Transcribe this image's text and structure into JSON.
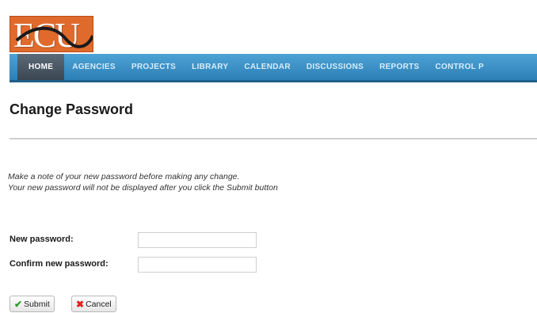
{
  "header": {
    "logo_text": "ECU",
    "nav_items": [
      {
        "label": "HOME",
        "active": true
      },
      {
        "label": "AGENCIES",
        "active": false
      },
      {
        "label": "PROJECTS",
        "active": false
      },
      {
        "label": "LIBRARY",
        "active": false
      },
      {
        "label": "CALENDAR",
        "active": false
      },
      {
        "label": "DISCUSSIONS",
        "active": false
      },
      {
        "label": "REPORTS",
        "active": false
      },
      {
        "label": "CONTROL P",
        "active": false
      }
    ]
  },
  "page": {
    "title": "Change Password",
    "notice_line1": "Make a note of your new password before making any change.",
    "notice_line2": "Your new password will not be displayed after you click the Submit button"
  },
  "form": {
    "new_password_label": "New password:",
    "new_password_value": "",
    "confirm_password_label": "Confirm new password:",
    "confirm_password_value": ""
  },
  "buttons": {
    "submit_label": "Submit",
    "cancel_label": "Cancel"
  },
  "colors": {
    "logo_bg": "#e06a2c",
    "nav_bg": "#3a8ec7",
    "nav_active_bg": "#4a5864"
  }
}
